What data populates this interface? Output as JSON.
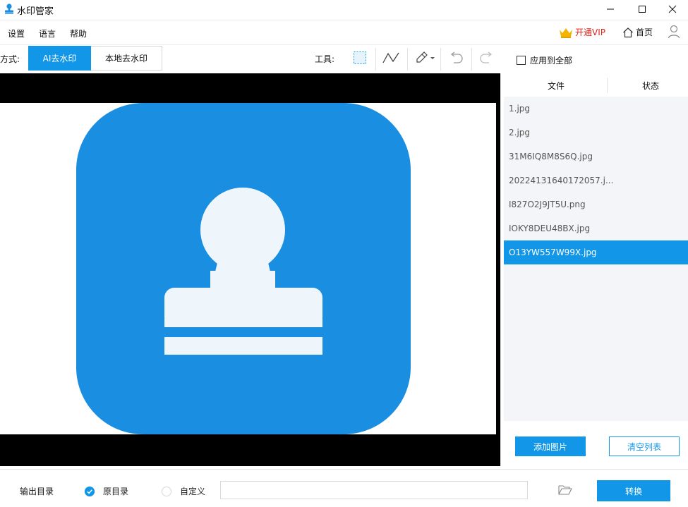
{
  "window": {
    "title": "水印管家",
    "app_icon": "stamp-user-icon"
  },
  "menu": {
    "settings": "设置",
    "language": "语言",
    "help": "帮助"
  },
  "header_right": {
    "vip_label": "开通VIP",
    "home_label": "首页",
    "vip_color": "#e0201a"
  },
  "mode": {
    "label": "方式:",
    "ai_remove": "AI去水印",
    "local_remove": "本地去水印",
    "active": "AI去水印"
  },
  "tools": {
    "label": "工具:",
    "items": [
      "rect-select-icon",
      "polyline-icon",
      "brush-icon",
      "undo-icon",
      "redo-icon"
    ]
  },
  "apply_all": {
    "label": "应用到全部",
    "checked": false
  },
  "file_panel": {
    "col_file": "文件",
    "col_status": "状态",
    "files": [
      {
        "name": "1.jpg",
        "selected": false
      },
      {
        "name": "2.jpg",
        "selected": false
      },
      {
        "name": "31M6IQ8M8S6Q.jpg",
        "selected": false
      },
      {
        "name": "20224131640172057.j...",
        "selected": false
      },
      {
        "name": "I827O2J9JT5U.png",
        "selected": false
      },
      {
        "name": "IOKY8DEU48BX.jpg",
        "selected": false
      },
      {
        "name": "O13YW557W99X.jpg",
        "selected": true
      }
    ],
    "add_button": "添加图片",
    "clear_button": "清空列表"
  },
  "output": {
    "label": "输出目录",
    "original_dir": "原目录",
    "custom": "自定义",
    "selected": "原目录",
    "path_value": "",
    "convert_button": "转换"
  },
  "colors": {
    "accent": "#1296e8",
    "preview_blue": "#1a8ee0",
    "stamp_white": "#eef6fb"
  }
}
